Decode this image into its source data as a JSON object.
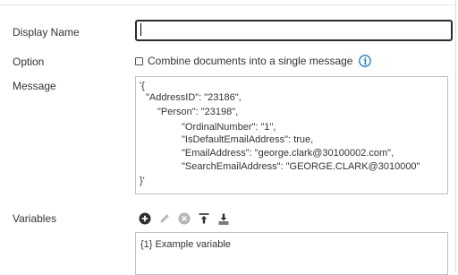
{
  "form": {
    "display_name_label": "Display Name",
    "display_name_value": "",
    "option_label": "Option",
    "option_checkbox_label": "Combine documents into a single message",
    "option_checked": false,
    "message_label": "Message",
    "message_lines": [
      "'{",
      "\"AddressID\": \"23186\",",
      "\"Person\": \"23198\",",
      "\"OrdinalNumber\": \"1\",",
      "\"IsDefaultEmailAddress\": true,",
      "\"EmailAddress\": \"george.clark@30100002.com\",",
      "\"SearchEmailAddress\": \"GEORGE.CLARK@3010000\"",
      "}'"
    ],
    "variables_label": "Variables",
    "variables_items": [
      "{1} Example variable"
    ]
  },
  "icons": {
    "info": "info-icon",
    "add": "add-circle-icon",
    "edit": "pencil-icon",
    "delete": "remove-circle-icon",
    "move_top": "move-to-top-icon",
    "move_bottom": "move-to-bottom-icon"
  },
  "colors": {
    "info_accent": "#1a7bb9",
    "icon_dark": "#2f2f2f",
    "icon_disabled": "#b5b5b5"
  }
}
